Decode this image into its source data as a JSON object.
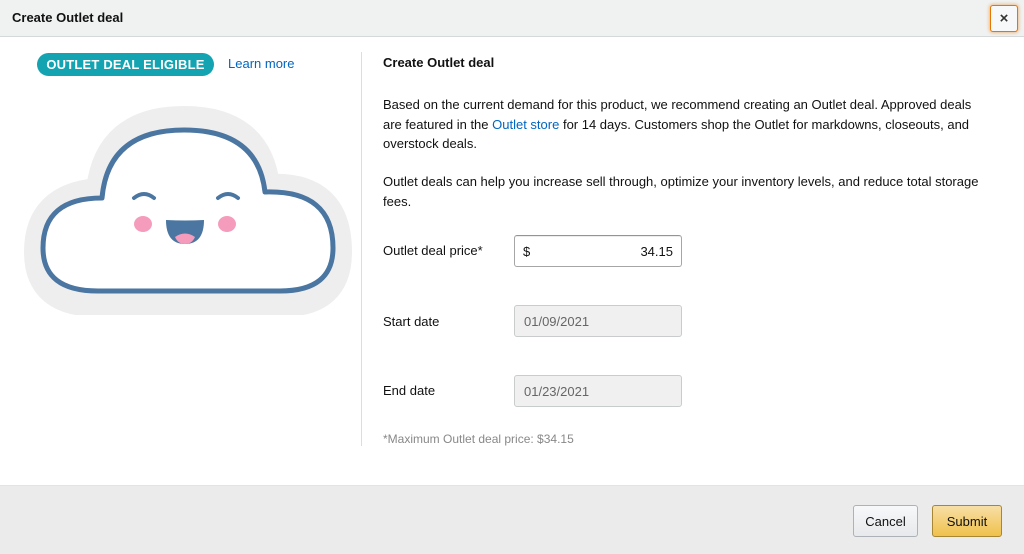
{
  "header": {
    "title": "Create Outlet deal",
    "close_label": "×"
  },
  "left": {
    "badge_label": "OUTLET DEAL ELIGIBLE",
    "learn_more_label": "Learn more"
  },
  "main": {
    "title": "Create Outlet deal",
    "para1_before_link": "Based on the current demand for this product, we recommend creating an Outlet deal. Approved deals are featured in the ",
    "para1_link": "Outlet store",
    "para1_after_link": " for 14 days. Customers shop the Outlet for markdowns, closeouts, and overstock deals.",
    "para2": "Outlet deals can help you increase sell through, optimize your inventory levels, and reduce total storage fees.",
    "price_label": "Outlet deal price*",
    "currency_symbol": "$",
    "price_value": "34.15",
    "start_label": "Start date",
    "start_value": "01/09/2021",
    "end_label": "End date",
    "end_value": "01/23/2021",
    "note": "*Maximum Outlet deal price: $34.15"
  },
  "footer": {
    "cancel_label": "Cancel",
    "submit_label": "Submit"
  },
  "colors": {
    "badge": "#13a3b1",
    "link": "#0066c0",
    "submit": "#f0c14b",
    "cloud_outline": "#4a76a1",
    "cheeks": "#f59bbb"
  }
}
